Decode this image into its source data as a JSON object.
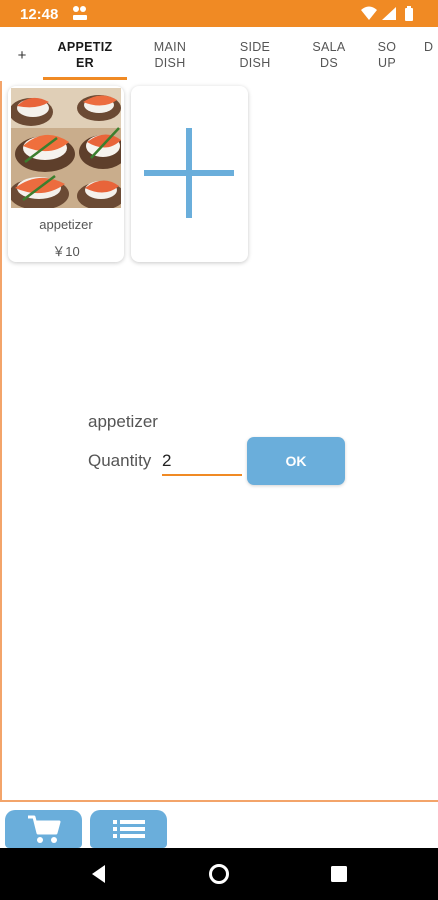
{
  "status_bar": {
    "time": "12:48",
    "background": "#f08a24",
    "icons": [
      "sim-status-icon",
      "wifi-icon",
      "signal-icon",
      "battery-icon"
    ]
  },
  "tabs": {
    "add_label": "+",
    "items": [
      {
        "label": "APPETIZ\nER",
        "active": true
      },
      {
        "label": "MAIN\nDISH",
        "active": false
      },
      {
        "label": "SIDE\nDISH",
        "active": false
      },
      {
        "label": "SALA\nDS",
        "active": false
      },
      {
        "label": "SO\nUP",
        "active": false
      },
      {
        "label": "D",
        "active": false
      }
    ]
  },
  "products": [
    {
      "name": "appetizer",
      "price": "￥10",
      "image": "smoked-salmon-appetizer-photo"
    }
  ],
  "add_card": {
    "icon": "plus-icon"
  },
  "quantity_dialog": {
    "item_name": "appetizer",
    "quantity_label": "Quantity",
    "quantity_value": "2",
    "ok_label": "OK"
  },
  "bottom_bar": {
    "buttons": [
      {
        "icon": "shopping-cart-icon"
      },
      {
        "icon": "list-icon"
      }
    ]
  },
  "nav_bar": {
    "icons": [
      "back-icon",
      "home-icon",
      "recents-icon"
    ]
  },
  "colors": {
    "accent": "#f08a24",
    "button": "#6aaedb"
  }
}
